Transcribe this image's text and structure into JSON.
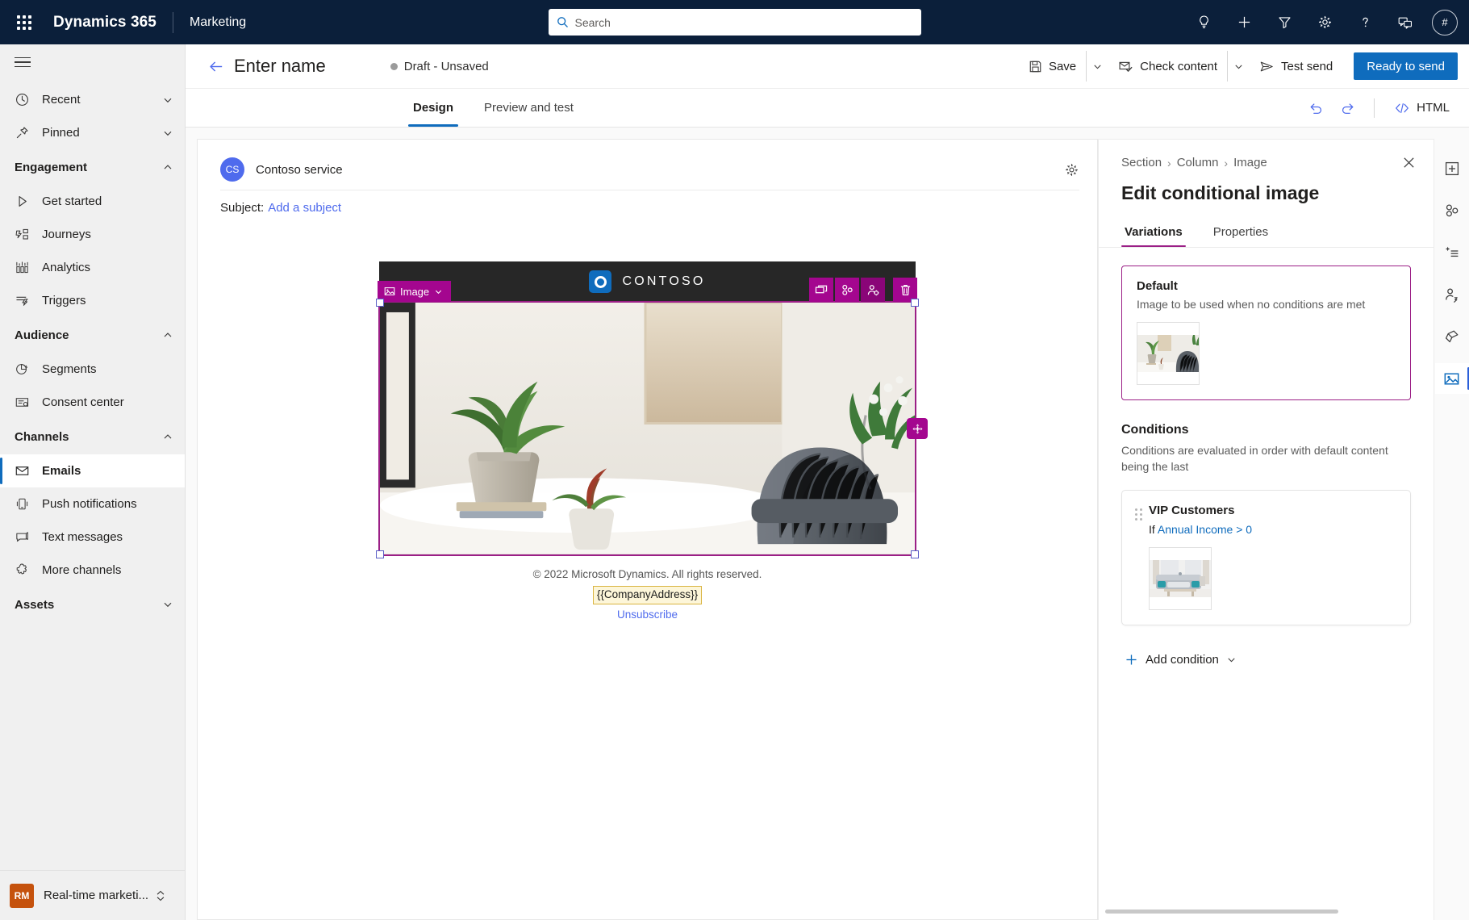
{
  "topnav": {
    "waffle_label": "app-launcher",
    "brand": "Dynamics 365",
    "app_name": "Marketing",
    "search": {
      "placeholder": "Search",
      "value": ""
    },
    "icons": [
      {
        "name": "lightbulb-icon",
        "label": "Insights"
      },
      {
        "name": "plus-icon",
        "label": "Quick create"
      },
      {
        "name": "filter-icon",
        "label": "Filter"
      },
      {
        "name": "gear-icon",
        "label": "Settings"
      },
      {
        "name": "help-icon",
        "label": "Help"
      },
      {
        "name": "feedback-icon",
        "label": "Feedback"
      }
    ],
    "avatar_initial": "#"
  },
  "sidebar": {
    "hamburger_label": "Expand navigation",
    "top_items": [
      {
        "label": "Recent",
        "icon": "clock-icon",
        "chevron": "down"
      },
      {
        "label": "Pinned",
        "icon": "pin-icon",
        "chevron": "down"
      }
    ],
    "groups": [
      {
        "label": "Engagement",
        "chevron": "up",
        "items": [
          {
            "label": "Get started",
            "icon": "play-icon"
          },
          {
            "label": "Journeys",
            "icon": "journeys-icon"
          },
          {
            "label": "Analytics",
            "icon": "analytics-icon"
          },
          {
            "label": "Triggers",
            "icon": "triggers-icon"
          }
        ]
      },
      {
        "label": "Audience",
        "chevron": "up",
        "items": [
          {
            "label": "Segments",
            "icon": "segments-icon"
          },
          {
            "label": "Consent center",
            "icon": "consent-icon"
          }
        ]
      },
      {
        "label": "Channels",
        "chevron": "up",
        "items": [
          {
            "label": "Emails",
            "icon": "mail-icon",
            "selected": true
          },
          {
            "label": "Push notifications",
            "icon": "push-icon"
          },
          {
            "label": "Text messages",
            "icon": "sms-icon"
          },
          {
            "label": "More channels",
            "icon": "more-channels-icon"
          }
        ]
      },
      {
        "label": "Assets",
        "chevron": "down",
        "items": []
      }
    ],
    "area_switcher": {
      "badge": "RM",
      "label": "Real-time marketi...",
      "chevron": "updown"
    }
  },
  "commandbar": {
    "back_label": "Back",
    "record_title": "Enter name",
    "status": "Draft - Unsaved",
    "save_label": "Save",
    "check_content_label": "Check content",
    "test_send_label": "Test send",
    "ready_to_send_label": "Ready to send"
  },
  "tabs": {
    "items": [
      {
        "label": "Design",
        "active": true
      },
      {
        "label": "Preview and test",
        "active": false
      }
    ],
    "undo_label": "Undo",
    "redo_label": "Redo",
    "html_label": "HTML"
  },
  "email": {
    "sender_initials": "CS",
    "sender_name": "Contoso service",
    "settings_label": "Message settings",
    "subject_label": "Subject:",
    "subject_link": "Add a subject",
    "brand_logo_text": "CONTOSO",
    "selected_element": {
      "tag_label": "Image",
      "tools": [
        {
          "name": "duplicate-icon",
          "label": "Duplicate"
        },
        {
          "name": "personalization-icon",
          "label": "Personalization"
        },
        {
          "name": "conditional-content-icon",
          "label": "Conditional content",
          "active": true
        },
        {
          "name": "delete-icon",
          "label": "Delete"
        }
      ],
      "drag_label": "Move element"
    },
    "footer": {
      "copyright": "© 2022 Microsoft Dynamics. All rights reserved.",
      "token": "{{CompanyAddress}}",
      "unsubscribe": "Unsubscribe"
    }
  },
  "right_panel": {
    "breadcrumb": [
      "Section",
      "Column",
      "Image"
    ],
    "close_label": "Close",
    "title": "Edit conditional image",
    "tabs": [
      {
        "label": "Variations",
        "active": true
      },
      {
        "label": "Properties",
        "active": false
      }
    ],
    "default_variation": {
      "title": "Default",
      "subtitle": "Image to be used when no conditions are met",
      "thumbnail_label": "default-image-thumbnail"
    },
    "conditions_section": {
      "title": "Conditions",
      "subtitle": "Conditions are evaluated in order with default content being the last",
      "items": [
        {
          "title": "VIP Customers",
          "if_label": "If",
          "expression": "Annual Income > 0",
          "thumbnail_label": "vip-image-thumbnail"
        }
      ],
      "add_label": "Add condition"
    }
  },
  "right_rail": {
    "buttons": [
      {
        "name": "add-element-icon",
        "label": "Elements"
      },
      {
        "name": "personalization-icon",
        "label": "Personalization"
      },
      {
        "name": "ai-assist-icon",
        "label": "Content ideas"
      },
      {
        "name": "conditional-content-icon",
        "label": "Conditional content"
      },
      {
        "name": "styles-icon",
        "label": "Styles"
      },
      {
        "name": "image-icon",
        "label": "Image",
        "active": true
      }
    ]
  },
  "colors": {
    "nav_bg": "#0b1f3a",
    "accent_blue": "#0f6cbd",
    "magenta": "#a4068f",
    "panel_accent": "#9b1f86",
    "orange_badge": "#c5520d",
    "link_blue": "#4f6bed"
  }
}
